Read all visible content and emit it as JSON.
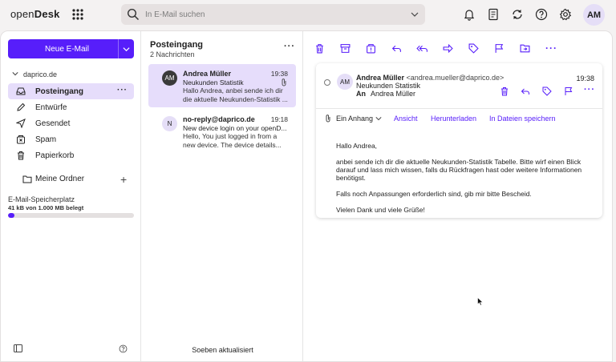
{
  "app": {
    "logo_light": "open",
    "logo_bold": "Desk"
  },
  "search": {
    "placeholder": "In E-Mail suchen"
  },
  "user": {
    "initials": "AM"
  },
  "sidebar": {
    "new_mail": "Neue E-Mail",
    "account": "daprico.de",
    "folders": [
      {
        "label": "Posteingang",
        "icon": "inbox-icon",
        "active": true
      },
      {
        "label": "Entwürfe",
        "icon": "pencil-icon"
      },
      {
        "label": "Gesendet",
        "icon": "send-icon"
      },
      {
        "label": "Spam",
        "icon": "spam-icon"
      },
      {
        "label": "Papierkorb",
        "icon": "trash-icon"
      }
    ],
    "my_folders": "Meine Ordner",
    "storage_title": "E-Mail-Speicherplatz",
    "storage_used": "41 kB von 1.000 MB belegt",
    "storage_fraction": 0.05
  },
  "list": {
    "title": "Posteingang",
    "count": "2 Nachrichten",
    "status": "Soeben aktualisiert",
    "messages": [
      {
        "initials": "AM",
        "from": "Andrea Müller",
        "time": "19:38",
        "subject": "Neukunden Statistik",
        "preview": "Hallo Andrea, anbei sende ich dir die aktuelle Neukunden-Statistik ..."
      },
      {
        "initials": "N",
        "from": "no-reply@daprico.de",
        "time": "19:18",
        "subject": "New device login on your openD...",
        "preview": "Hello, You just logged in from a new device. The device details..."
      }
    ]
  },
  "mail": {
    "initials": "AM",
    "sender_name": "Andrea Müller",
    "sender_addr": "<andrea.mueller@daprico.de>",
    "subject": "Neukunden Statistik",
    "to_label": "An",
    "to_name": "Andrea Müller",
    "time": "19:38",
    "attachment": "Ein Anhang",
    "view": "Ansicht",
    "download": "Herunterladen",
    "save": "In Dateien speichern",
    "body": [
      "Hallo Andrea,",
      "anbei sende ich dir die aktuelle Neukunden-Statistik Tabelle. Bitte wirf einen Blick darauf und lass mich wissen, falls du Rückfragen hast oder weitere Informationen benötigst.",
      "Falls noch Anpassungen erforderlich sind, gib mir bitte Bescheid.",
      "Vielen Dank und viele Grüße!"
    ]
  },
  "colors": {
    "accent": "#571efa",
    "selected": "#e6ddfb"
  }
}
